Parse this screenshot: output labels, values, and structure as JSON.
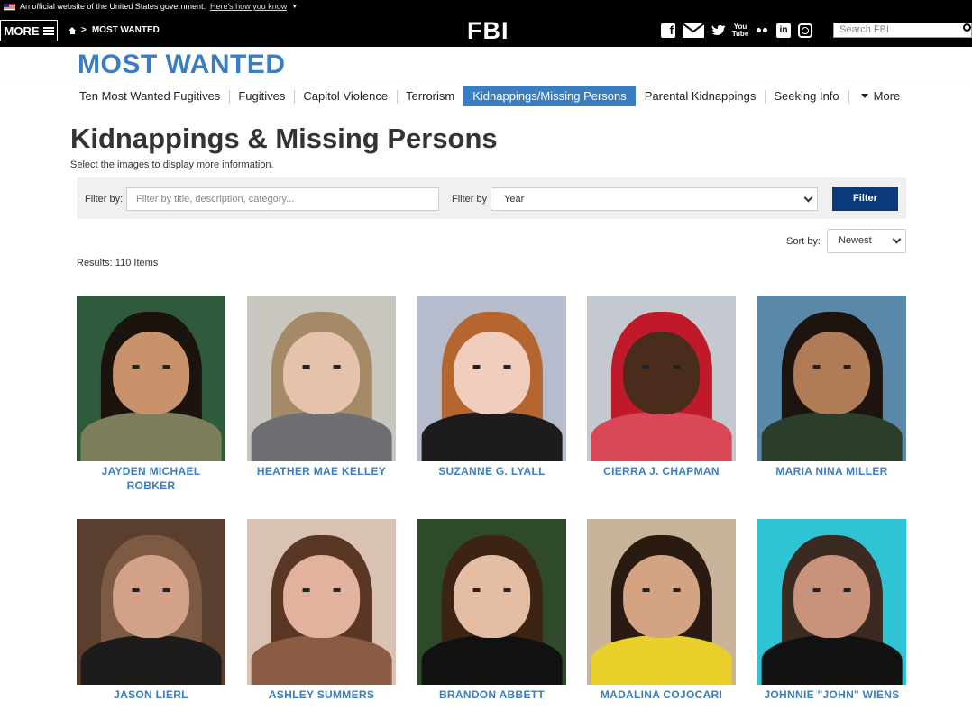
{
  "gov_banner": {
    "text": "An official website of the United States government.",
    "link": "Here's how you know"
  },
  "topnav": {
    "more_label": "MORE",
    "breadcrumb": "MOST WANTED",
    "logo": "FBI",
    "social": [
      "facebook-icon",
      "mail-icon",
      "twitter-icon",
      "youtube-icon",
      "flickr-icon",
      "linkedin-icon",
      "instagram-icon"
    ],
    "search_placeholder": "Search FBI"
  },
  "section_title": "MOST WANTED",
  "tabs": [
    {
      "label": "Ten Most Wanted Fugitives",
      "active": false
    },
    {
      "label": "Fugitives",
      "active": false
    },
    {
      "label": "Capitol Violence",
      "active": false
    },
    {
      "label": "Terrorism",
      "active": false
    },
    {
      "label": "Kidnappings/Missing Persons",
      "active": true
    },
    {
      "label": "Parental Kidnappings",
      "active": false
    },
    {
      "label": "Seeking Info",
      "active": false
    },
    {
      "label": "More",
      "active": false
    }
  ],
  "page": {
    "title": "Kidnappings & Missing Persons",
    "subtitle": "Select the images to display more information."
  },
  "filter": {
    "label1": "Filter by:",
    "input_placeholder": "Filter by title, description, category...",
    "label2": "Filter by",
    "select_value": "Year",
    "button": "Filter"
  },
  "sort": {
    "label": "Sort by:",
    "value": "Newest"
  },
  "results": "Results: 110 Items",
  "colors": {
    "brand_blue": "#3a7ec1",
    "button_navy": "#0a3a7a"
  },
  "people": [
    {
      "name": "JAYDEN MICHAEL ROBKER",
      "bg": "#2f5a3c",
      "skin": "#c9926a",
      "hair": "#1b130e",
      "body": "#7d7f5c"
    },
    {
      "name": "HEATHER MAE KELLEY",
      "bg": "#c9c6c0",
      "skin": "#e6c2ad",
      "hair": "#a48a66",
      "body": "#6d6f73"
    },
    {
      "name": "SUZANNE G. LYALL",
      "bg": "#b7bccc",
      "skin": "#f0cdbd",
      "hair": "#b5652f",
      "body": "#1e1b1e"
    },
    {
      "name": "CIERRA J. CHAPMAN",
      "bg": "#c4c8cf",
      "skin": "#4a2c1c",
      "hair": "#c01a2a",
      "body": "#d94758"
    },
    {
      "name": "MARIA NINA MILLER",
      "bg": "#5a88a8",
      "skin": "#b07c55",
      "hair": "#1e140f",
      "body": "#2b3d2b"
    },
    {
      "name": "JASON LIERL",
      "bg": "#5a3e2e",
      "skin": "#d3a088",
      "hair": "#7c5a44",
      "body": "#1c1c1c"
    },
    {
      "name": "ASHLEY SUMMERS",
      "bg": "#d9c2b4",
      "skin": "#e1b29d",
      "hair": "#5a3624",
      "body": "#8c5b44"
    },
    {
      "name": "BRANDON ABBETT",
      "bg": "#2f4a2a",
      "skin": "#e4bda3",
      "hair": "#3d2314",
      "body": "#111111"
    },
    {
      "name": "MADALINA COJOCARI",
      "bg": "#c9b49b",
      "skin": "#d4a383",
      "hair": "#2a1b12",
      "body": "#e9cf2a"
    },
    {
      "name": "JOHNNIE \"JOHN\" WIENS",
      "bg": "#2fc3d6",
      "skin": "#c9927a",
      "hair": "#3a2a22",
      "body": "#121212"
    }
  ]
}
